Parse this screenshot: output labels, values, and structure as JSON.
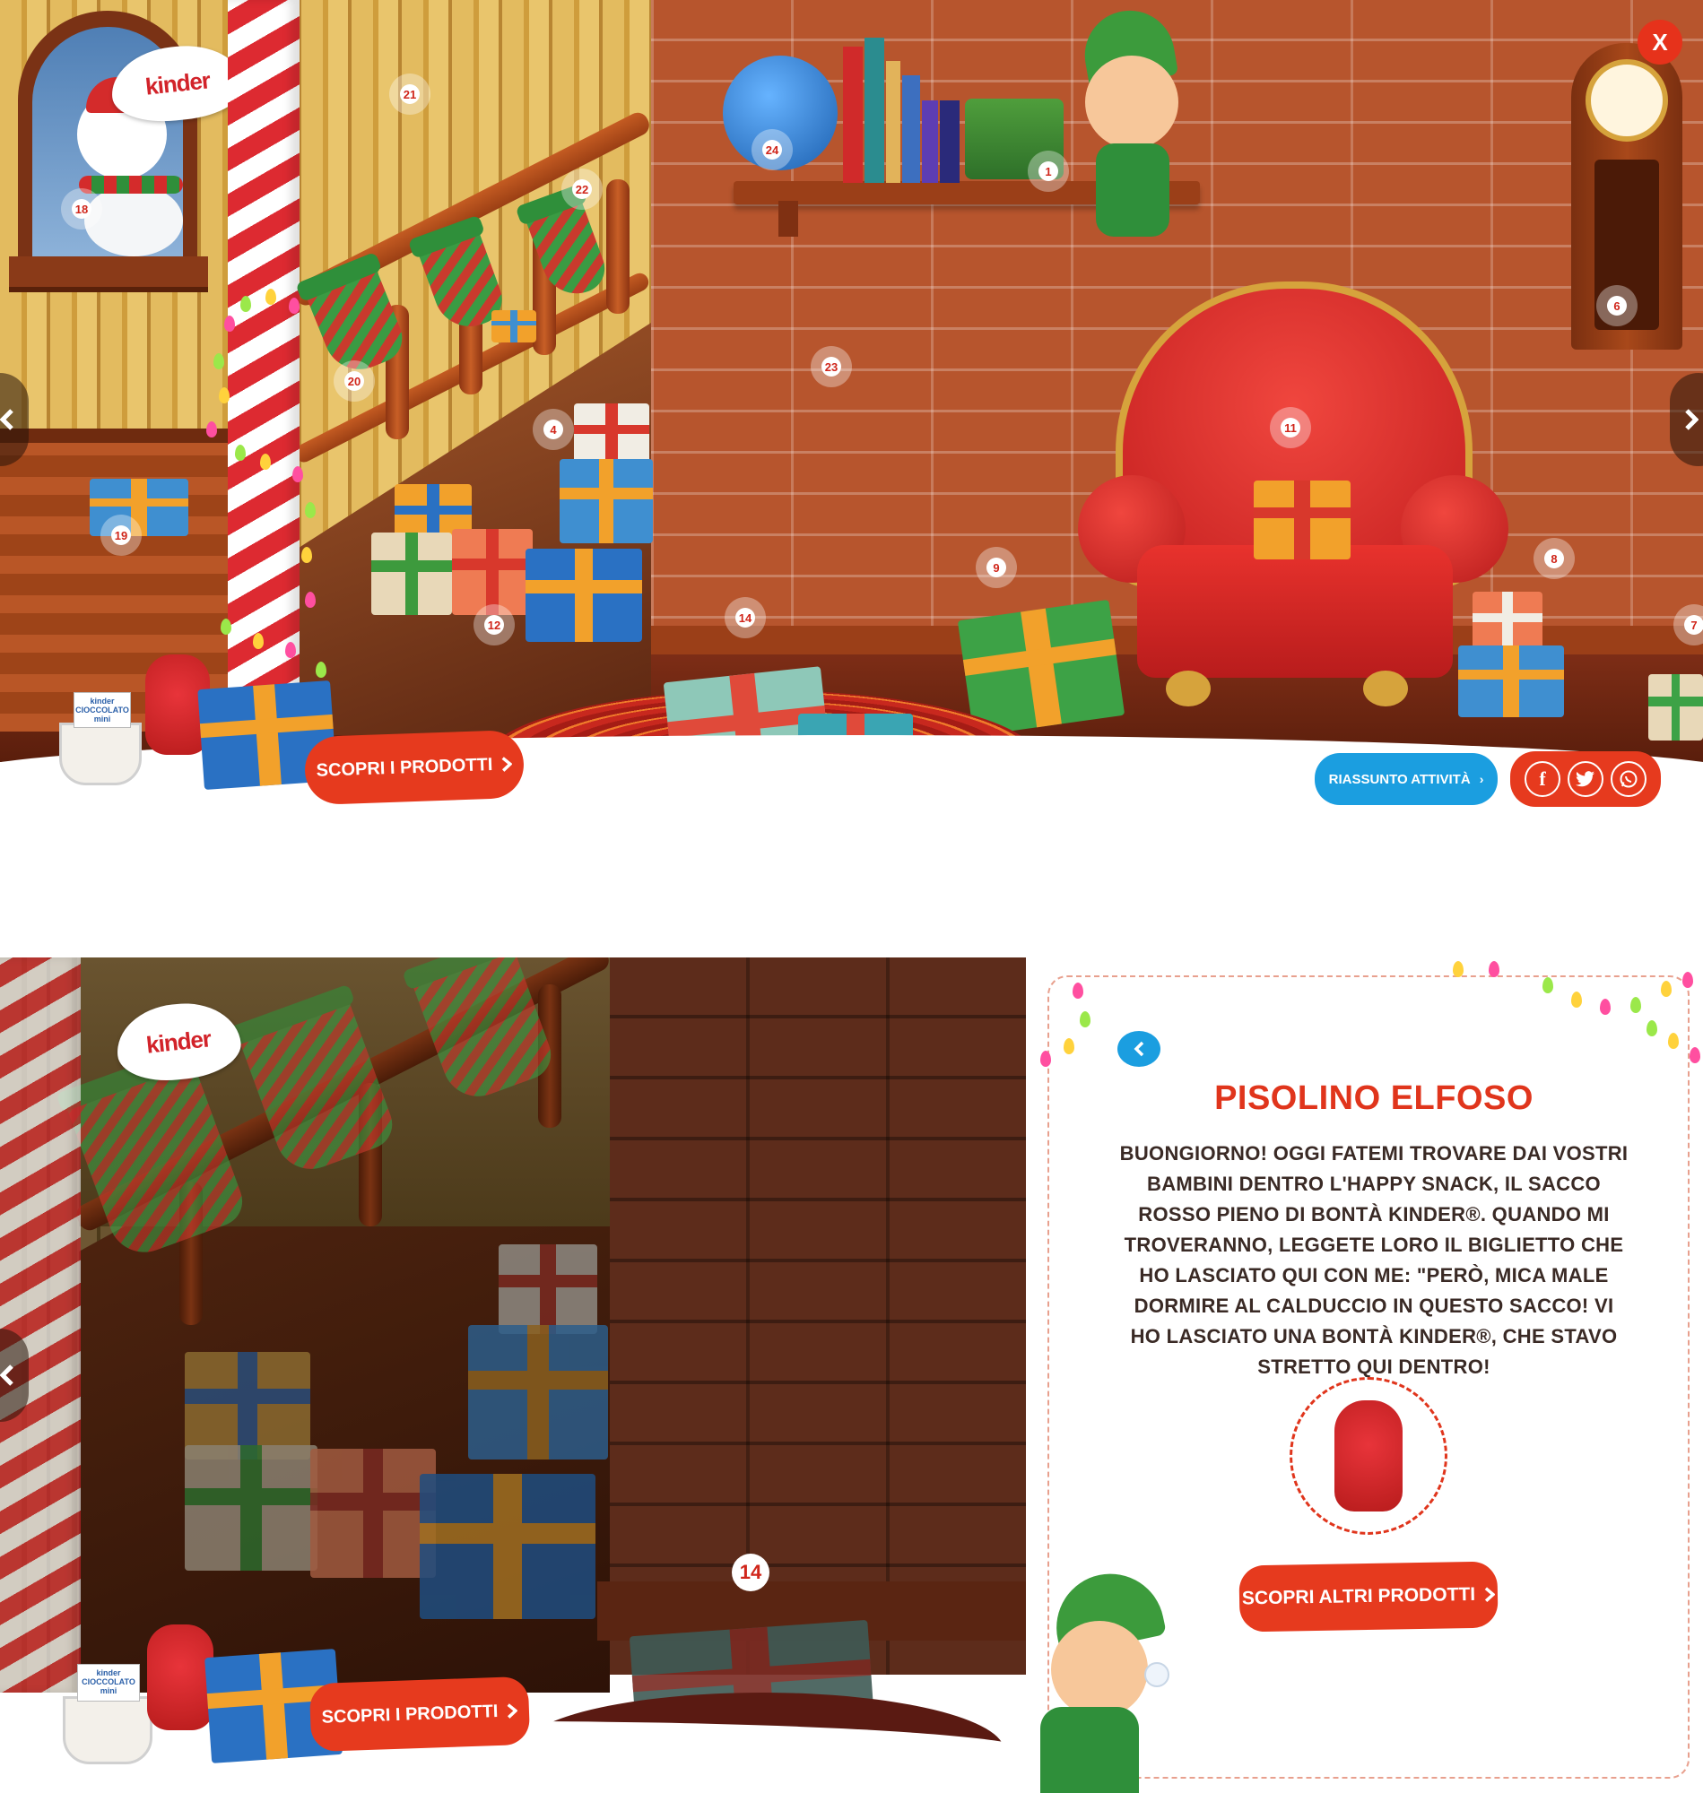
{
  "top_view": {
    "logo_text": "kinder",
    "close_label": "X",
    "nav_prev_icon": "chevron-left-icon",
    "nav_next_icon": "chevron-right-icon",
    "badges": {
      "b1": "1",
      "b4": "4",
      "b6": "6",
      "b7": "7",
      "b8": "8",
      "b9": "9",
      "b11": "11",
      "b12": "12",
      "b14": "14",
      "b18": "18",
      "b19": "19",
      "b20": "20",
      "b21": "21",
      "b22": "22",
      "b23": "23",
      "b24": "24"
    },
    "products_button_label": "SCOPRI I PRODOTTI",
    "products_mini_text": "kinder CIOCCOLATO mini",
    "activity_button_label": "RIASSUNTO ATTIVITÀ",
    "share_icons": [
      "facebook-icon",
      "twitter-icon",
      "whatsapp-icon"
    ]
  },
  "bottom_view": {
    "logo_text": "kinder",
    "highlight_badge": "14",
    "products_button_label": "SCOPRI I PRODOTTI",
    "products_mini_text": "kinder CIOCCOLATO mini",
    "panel": {
      "back_icon": "chevron-left-icon",
      "title": "PISOLINO ELFOSO",
      "body": "BUONGIORNO! OGGI FATEMI TROVARE DAI VOSTRI BAMBINI DENTRO L'HAPPY SNACK, IL SACCO ROSSO PIENO DI BONTÀ KINDER®. QUANDO MI TROVERANNO, LEGGETE LORO IL BIGLIETTO CHE HO LASCIATO QUI CON ME: \"PERÒ, MICA MALE DORMIRE AL CALDUCCIO IN QUESTO SACCO! VI HO LASCIATO UNA BONTÀ KINDER®, CHE STAVO STRETTO QUI DENTRO!",
      "button_label": "SCOPRI ALTRI PRODOTTI"
    }
  },
  "colors": {
    "brand_red": "#e63a1e",
    "activity_blue": "#1b9ee0",
    "title_red": "#e0351c",
    "badge_text": "#d0261b"
  }
}
